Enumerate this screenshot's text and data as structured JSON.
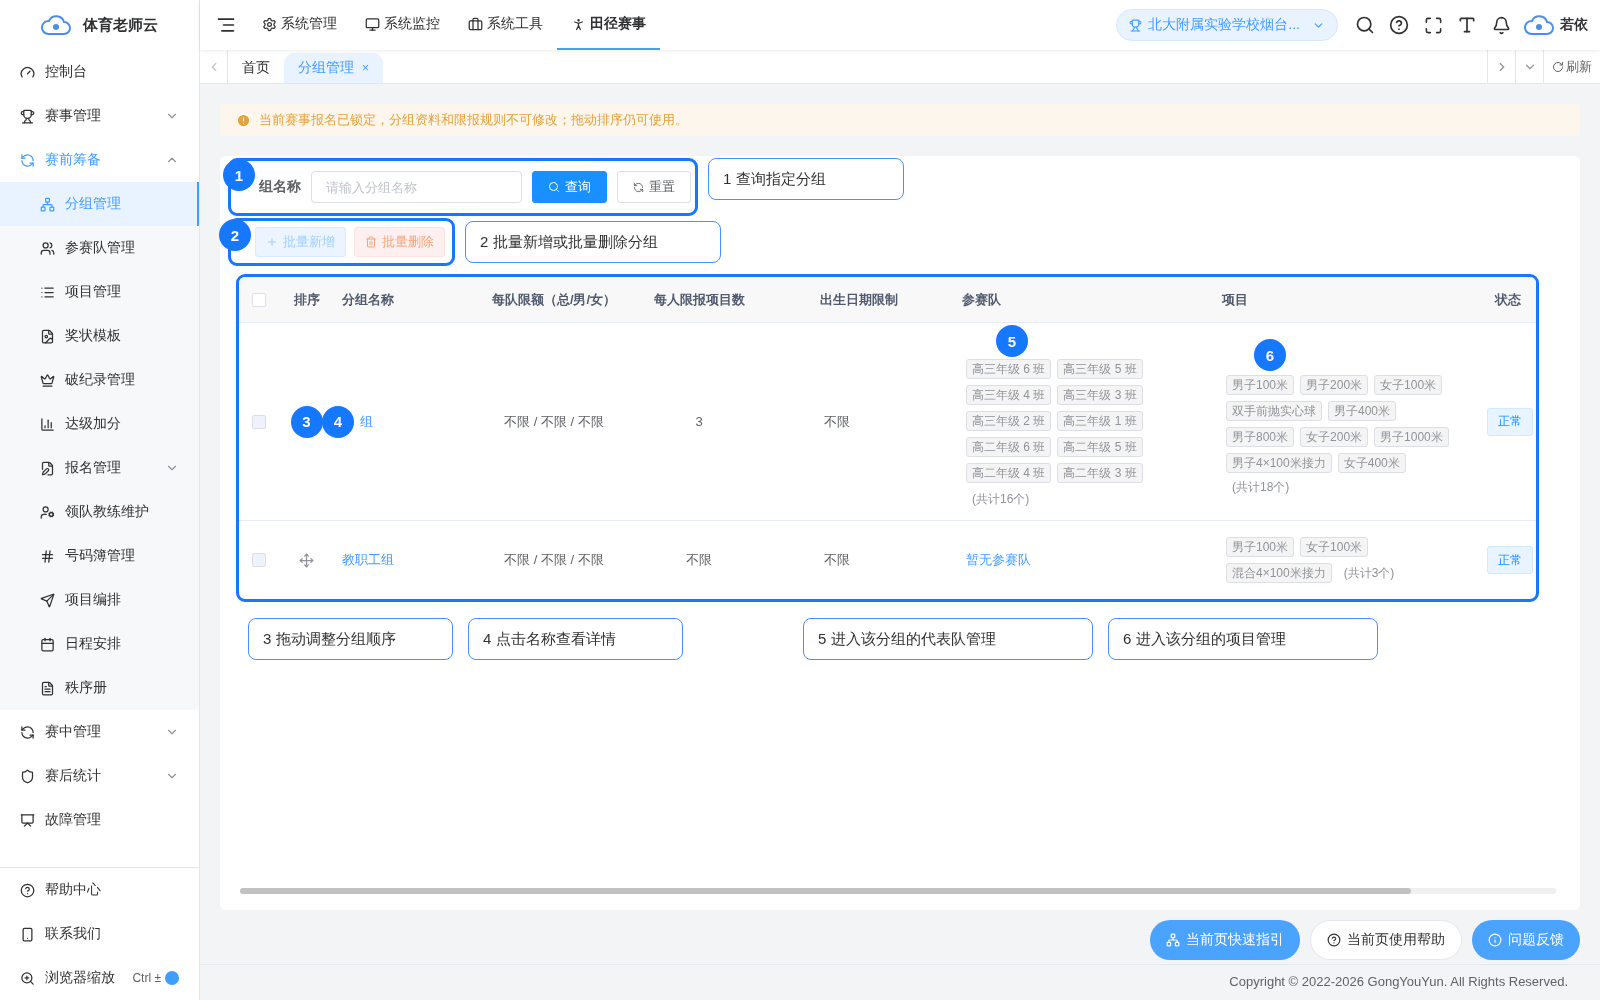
{
  "brand": {
    "name": "体育老师云"
  },
  "sidebar": {
    "items": [
      {
        "label": "控制台",
        "selected": false
      },
      {
        "label": "赛事管理",
        "expanded": false,
        "selected": false
      },
      {
        "label": "赛前筹备",
        "expanded": true,
        "selected": true,
        "children": [
          {
            "label": "分组管理",
            "selected": true
          },
          {
            "label": "参赛队管理",
            "selected": false
          },
          {
            "label": "项目管理",
            "selected": false
          },
          {
            "label": "奖状模板",
            "selected": false
          },
          {
            "label": "破纪录管理",
            "selected": false
          },
          {
            "label": "达级加分",
            "selected": false
          },
          {
            "label": "报名管理",
            "selected": false,
            "expanded": false
          },
          {
            "label": "领队教练维护",
            "selected": false
          },
          {
            "label": "号码簿管理",
            "selected": false
          },
          {
            "label": "项目编排",
            "selected": false
          },
          {
            "label": "日程安排",
            "selected": false
          },
          {
            "label": "秩序册",
            "selected": false
          }
        ]
      },
      {
        "label": "赛中管理",
        "expanded": false,
        "selected": false
      },
      {
        "label": "赛后统计",
        "expanded": false,
        "selected": false
      },
      {
        "label": "故障管理",
        "selected": false
      }
    ],
    "bottom": [
      {
        "label": "帮助中心"
      },
      {
        "label": "联系我们"
      },
      {
        "label": "浏览器缩放",
        "shortcut": "Ctrl ±"
      }
    ]
  },
  "top_nav": {
    "items": [
      {
        "label": "系统管理",
        "selected": false
      },
      {
        "label": "系统监控",
        "selected": false
      },
      {
        "label": "系统工具",
        "selected": false
      },
      {
        "label": "田径赛事",
        "selected": true
      }
    ],
    "school_select": {
      "value": "北大附属实验学校烟台..."
    },
    "user": "若依"
  },
  "tabs": {
    "items": [
      {
        "label": "首页",
        "selected": false,
        "closable": false
      },
      {
        "label": "分组管理",
        "selected": true,
        "closable": true
      }
    ],
    "close_glyph": "×",
    "refresh": "刷新"
  },
  "alert": {
    "text": "当前赛事报名已锁定，分组资料和限报规则不可修改；拖动排序仍可使用。"
  },
  "search": {
    "label": "组名称",
    "placeholder": "请输入分组名称",
    "query_button": "查询",
    "reset_button": "重置"
  },
  "toolbar": {
    "add_button": "批量新增",
    "delete_button": "批量删除"
  },
  "table": {
    "all_checked": false,
    "columns": [
      "排序",
      "分组名称",
      "每队限额（总/男/女）",
      "每人限报项目数",
      "出生日期限制",
      "参赛队",
      "项目",
      "状态"
    ],
    "rows": [
      {
        "checked": false,
        "name": "组",
        "quota": "不限 / 不限 / 不限",
        "max_events": "3",
        "birth_limit": "不限",
        "teams": {
          "kind": "tags",
          "tags": [
            "高三年级 6 班",
            "高三年级 5 班",
            "高三年级 4 班",
            "高三年级 3 班",
            "高三年级 2 班",
            "高三年级 1 班",
            "高二年级 6 班",
            "高二年级 5 班",
            "高二年级 4 班",
            "高二年级 3 班"
          ],
          "count": "(共计16个)"
        },
        "event_lines": [
          [
            {
              "kind": "tag",
              "text": "男子100米"
            },
            {
              "kind": "tag",
              "text": "男子200米"
            },
            {
              "kind": "tag",
              "text": "女子100米"
            }
          ],
          [
            {
              "kind": "tag",
              "text": "双手前抛实心球"
            },
            {
              "kind": "tag",
              "text": "男子400米"
            }
          ],
          [
            {
              "kind": "tag",
              "text": "男子800米"
            },
            {
              "kind": "tag",
              "text": "女子200米"
            },
            {
              "kind": "tag",
              "text": "男子1000米"
            }
          ],
          [
            {
              "kind": "tag",
              "text": "男子4×100米接力"
            },
            {
              "kind": "tag",
              "text": "女子400米"
            }
          ],
          [
            {
              "kind": "count",
              "text": "(共计18个)"
            }
          ]
        ],
        "status": "正常"
      },
      {
        "checked": false,
        "name": "教职工组",
        "quota": "不限 / 不限 / 不限",
        "max_events": "不限",
        "birth_limit": "不限",
        "teams": {
          "kind": "empty",
          "text": "暂无参赛队"
        },
        "event_lines": [
          [
            {
              "kind": "tag",
              "text": "男子100米"
            },
            {
              "kind": "tag",
              "text": "女子100米"
            }
          ],
          [
            {
              "kind": "tag",
              "text": "混合4×100米接力"
            },
            {
              "kind": "count",
              "text": "(共计3个)"
            }
          ]
        ],
        "status": "正常"
      }
    ]
  },
  "guide": {
    "markers": [
      "1",
      "2",
      "3",
      "4",
      "5",
      "6"
    ],
    "callouts": [
      "1 查询指定分组",
      "2 批量新增或批量删除分组",
      "3 拖动调整分组顺序",
      "4 点击名称查看详情",
      "5 进入该分组的代表队管理",
      "6 进入该分组的项目管理"
    ]
  },
  "help_buttons": [
    "当前页快速指引",
    "当前页使用帮助",
    "问题反馈"
  ],
  "footer": "Copyright © 2022-2026 GongYouYun. All Rights Reserved."
}
